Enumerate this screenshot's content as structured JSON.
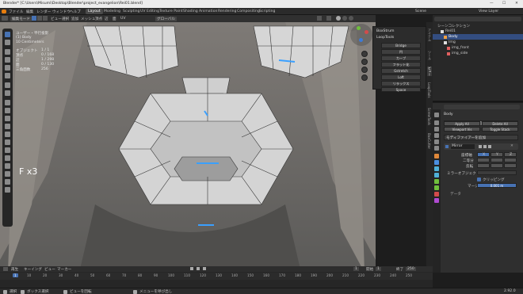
{
  "titlebar": {
    "title": "Blender* [C:\\Users\\Misumi\\Desktop\\Blender\\project_evangelion\\Rei01.blend]",
    "min": "—",
    "max": "☐",
    "close": "✕"
  },
  "menu": {
    "items": [
      "ファイル",
      "編集",
      "レンダー",
      "ウィンドウ",
      "ヘルプ"
    ],
    "workspaces": [
      "Layout",
      "Modeling",
      "Sculpting",
      "UV Editing",
      "Texture Paint",
      "Shading",
      "Animation",
      "Rendering",
      "Compositing",
      "Scripting"
    ],
    "active_workspace": "Layout",
    "scene_label": "Scene",
    "view_layer": "View Layer"
  },
  "viewport_header": {
    "mode": "編集モード",
    "items": [
      "ビュー",
      "選択",
      "追加",
      "メッシュ",
      "頂点",
      "辺",
      "面",
      "UV"
    ],
    "orientation": "グローバル"
  },
  "overlay": {
    "view_name": "ユーザー・平行投影",
    "object_line": "(1) Body",
    "units": "10 Centimeters",
    "object_label": "オブジェクト",
    "object_value": "1 / 1",
    "vertex_label": "頂点",
    "vertex_value": "0 / 168",
    "edge_label": "辺",
    "edge_value": "1 / 298",
    "face_label": "面",
    "face_value": "0 / 130",
    "tri_label": "三角面数",
    "tri_value": "256"
  },
  "fx_label": "F x3",
  "n_panel": {
    "section1": "BoxStrum",
    "section2": "LoopTools",
    "buttons": [
      "Bridge",
      "円",
      "カーブ",
      "フラット化",
      "Gstretch",
      "Loft",
      "リラックス",
      "Space"
    ]
  },
  "n_tabs": [
    "アイテム",
    "ツール",
    "ビュー",
    "LoopTools",
    "ScrewTools",
    "BoxCutter"
  ],
  "outliner": {
    "title": "シーンコレクション",
    "rows": [
      {
        "label": "Rei01",
        "level": 0
      },
      {
        "label": "Body",
        "level": 1,
        "selected": true
      },
      {
        "label": "Img",
        "level": 1
      },
      {
        "label": "img_front",
        "level": 2
      },
      {
        "label": "img_side",
        "level": 2
      }
    ]
  },
  "properties": {
    "search_placeholder": "",
    "object_name": "Body",
    "modifier_menu": "モディファイアーを追加",
    "buttons": [
      "Apply All",
      "Viewport Vis",
      "Delete All",
      "Toggle Stack"
    ],
    "modifier_name": "Mirror",
    "axis_label": "座標軸",
    "axes": [
      "X",
      "Y",
      "Z"
    ],
    "bisect_label": "二等分",
    "flip_label": "反転",
    "mirror_object_label": "ミラーオブジェクト",
    "clipping_label": "クリッピング",
    "merge_label": "マージ",
    "merge_value": "0.001 m",
    "data_label": "データ"
  },
  "timeline": {
    "menu": [
      "再生",
      "キーイング",
      "ビュー",
      "マーカー"
    ],
    "start_label": "開始",
    "start_value": "1",
    "end_label": "終了",
    "end_value": "250",
    "current_frame": "1",
    "ticks": [
      "0",
      "10",
      "20",
      "30",
      "40",
      "50",
      "60",
      "70",
      "80",
      "90",
      "100",
      "110",
      "120",
      "130",
      "140",
      "150",
      "160",
      "170",
      "180",
      "190",
      "200",
      "210",
      "220",
      "230",
      "240",
      "250"
    ]
  },
  "status": {
    "select": "選択",
    "box_select": "ボックス選択",
    "rotate": "ビューを回転",
    "menu": "メニューを呼び出し",
    "version": "2.92.0"
  },
  "colors": {
    "accent": "#4772b3",
    "selected_edge": "#3aa0ff",
    "mesh_face": "#d8d8d8"
  }
}
